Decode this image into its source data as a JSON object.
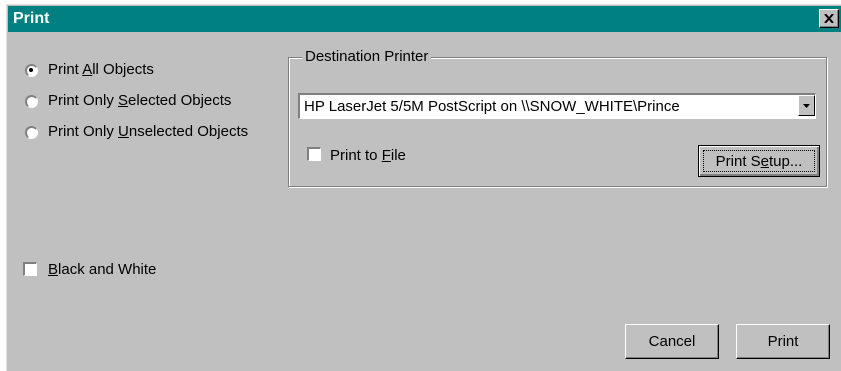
{
  "window": {
    "title": "Print",
    "close_label": "×"
  },
  "print_options": [
    {
      "pre": "Print ",
      "key": "A",
      "post": "ll Objects",
      "checked": true
    },
    {
      "pre": "Print Only ",
      "key": "S",
      "post": "elected Objects",
      "checked": false
    },
    {
      "pre": "Print Only ",
      "key": "U",
      "post": "nselected Objects",
      "checked": false
    }
  ],
  "black_white": {
    "key": "B",
    "post": "lack and White",
    "checked": false
  },
  "destination": {
    "group_label": "Destination Printer",
    "printer": "HP LaserJet 5/5M PostScript on \\\\SNOW_WHITE\\Prince",
    "print_to_file": {
      "pre": "Print to ",
      "key": "F",
      "post": "ile",
      "checked": false
    },
    "setup_button": {
      "pre": "Print S",
      "key": "e",
      "post": "tup..."
    }
  },
  "buttons": {
    "cancel": "Cancel",
    "print": "Print"
  },
  "icons": {
    "close": "close-icon",
    "dropdown": "chevron-down-icon"
  }
}
